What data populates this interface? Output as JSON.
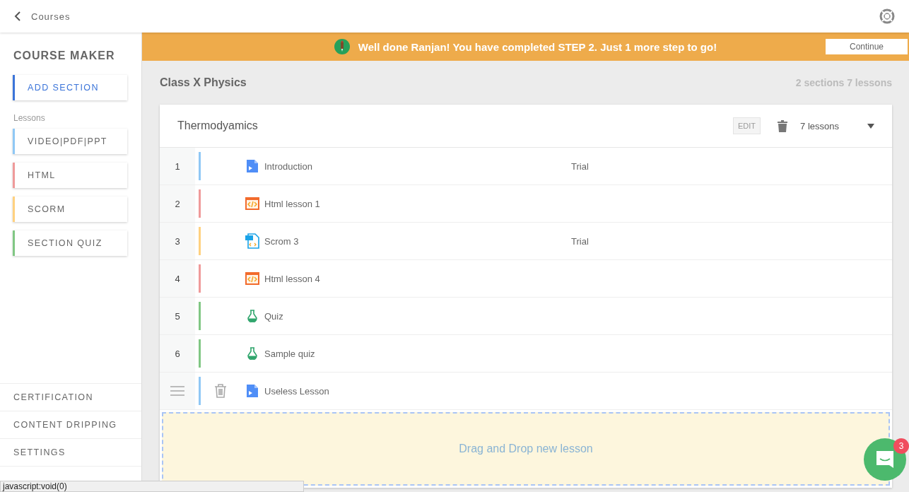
{
  "header": {
    "back_label": "Courses"
  },
  "sidebar": {
    "title": "COURSE MAKER",
    "add_button": {
      "label": "ADD SECTION",
      "color": "#3b74d9"
    },
    "lessons_label": "Lessons",
    "lesson_types": [
      {
        "label": "VIDEO|PDF|PPT",
        "color": "#90c8f5"
      },
      {
        "label": "HTML",
        "color": "#ef9a9a"
      },
      {
        "label": "SCORM",
        "color": "#ffd180"
      },
      {
        "label": "SECTION QUIZ",
        "color": "#81c784"
      }
    ],
    "bottom_items": [
      {
        "label": "CERTIFICATION",
        "selected": false
      },
      {
        "label": "CONTENT DRIPPING",
        "selected": false
      },
      {
        "label": "SETTINGS",
        "selected": false
      }
    ]
  },
  "banner": {
    "message": "Well done Ranjan! You have completed STEP 2. Just 1 more step to go!",
    "button": "Continue"
  },
  "course": {
    "title": "Class X Physics",
    "summary": "2 sections 7 lessons"
  },
  "section": {
    "title": "Thermodyamics",
    "edit": "EDIT",
    "count": "7 lessons",
    "expanded": true,
    "lessons": [
      {
        "number": "1",
        "kind": "video",
        "title": "Introduction",
        "tag": "Trial",
        "hovered": false
      },
      {
        "number": "2",
        "kind": "html",
        "title": "Html lesson 1",
        "hovered": false
      },
      {
        "number": "3",
        "kind": "scorm",
        "title": "Scrom 3",
        "tag": "Trial",
        "hovered": false
      },
      {
        "number": "4",
        "kind": "html",
        "title": "Html lesson 4",
        "hovered": false
      },
      {
        "number": "5",
        "kind": "quiz",
        "title": "Quiz",
        "hovered": false
      },
      {
        "number": "6",
        "kind": "quiz",
        "title": "Sample quiz",
        "hovered": false
      },
      {
        "kind": "video",
        "title": "Useless Lesson",
        "hovered": true
      }
    ],
    "dropzone": "Drag and Drop new lesson"
  },
  "chat": {
    "badge": "3"
  },
  "status_bar": "javascript:void(0)"
}
